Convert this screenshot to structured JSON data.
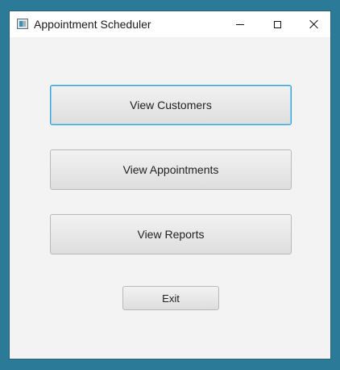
{
  "window": {
    "title": "Appointment Scheduler",
    "controls": {
      "minimize": "minimize",
      "maximize": "maximize",
      "close": "close"
    }
  },
  "main": {
    "buttons": {
      "customers": "View Customers",
      "appointments": "View Appointments",
      "reports": "View Reports",
      "exit": "Exit"
    }
  },
  "colors": {
    "desktop": "#2b7a98",
    "window_bg": "#f3f3f3",
    "focus_ring": "#2f9fd6"
  }
}
